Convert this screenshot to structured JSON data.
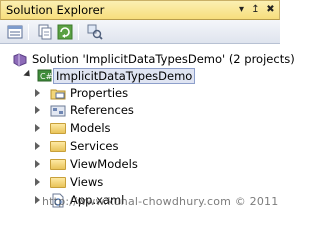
{
  "window": {
    "title": "Solution Explorer",
    "pin_glyph": "↥",
    "close_glyph": "✖"
  },
  "toolbar": {
    "buttons": [
      {
        "name": "properties-button",
        "icon": "properties-icon"
      },
      {
        "name": "show-all-files-button",
        "icon": "show-all-files-icon"
      },
      {
        "name": "refresh-button",
        "icon": "refresh-icon"
      },
      {
        "name": "class-view-button",
        "icon": "class-view-icon"
      }
    ]
  },
  "tree": {
    "solution": "Solution 'ImplicitDataTypesDemo' (2 projects)",
    "project": "ImplicitDataTypesDemo",
    "items": [
      {
        "label": "Properties",
        "icon": "properties-folder-icon"
      },
      {
        "label": "References",
        "icon": "references-icon"
      },
      {
        "label": "Models",
        "icon": "folder-icon"
      },
      {
        "label": "Services",
        "icon": "folder-icon"
      },
      {
        "label": "ViewModels",
        "icon": "folder-icon"
      },
      {
        "label": "Views",
        "icon": "folder-icon"
      },
      {
        "label": "App.xaml",
        "icon": "xaml-file-icon"
      }
    ]
  },
  "watermark": "http://www.kunal-chowdhury.com © 2011",
  "colors": {
    "title_bg_top": "#fbf0b2",
    "title_bg_bottom": "#f7de7c",
    "selection_bg": "#dfe4f2",
    "selection_border": "#8d9fcb"
  }
}
